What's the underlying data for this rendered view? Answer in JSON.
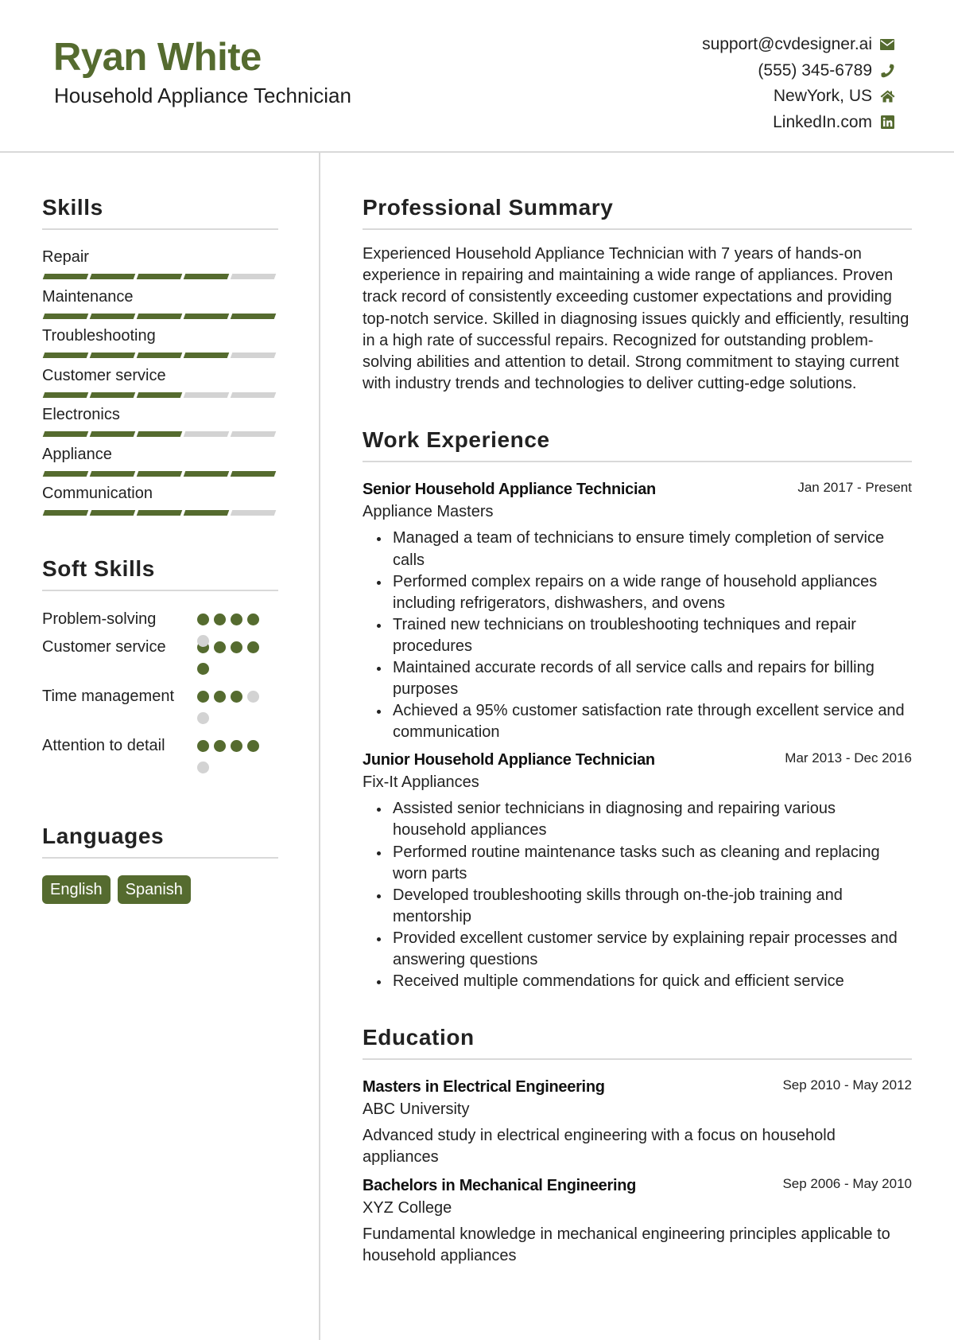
{
  "header": {
    "name": "Ryan White",
    "title": "Household Appliance Technician",
    "contacts": [
      {
        "text": "support@cvdesigner.ai",
        "icon": "envelope-icon"
      },
      {
        "text": "(555) 345-6789",
        "icon": "phone-icon"
      },
      {
        "text": "NewYork, US",
        "icon": "home-icon"
      },
      {
        "text": "LinkedIn.com",
        "icon": "linkedin-icon"
      }
    ]
  },
  "colors": {
    "accent": "#556b2f",
    "inactive": "#d3d3d3",
    "divider": "#d9d9d9"
  },
  "sidebar": {
    "skills": {
      "heading": "Skills",
      "max": 5,
      "items": [
        {
          "name": "Repair",
          "level": 4
        },
        {
          "name": "Maintenance",
          "level": 5
        },
        {
          "name": "Troubleshooting",
          "level": 4
        },
        {
          "name": "Customer service",
          "level": 3
        },
        {
          "name": "Electronics",
          "level": 3
        },
        {
          "name": "Appliance",
          "level": 5
        },
        {
          "name": "Communication",
          "level": 4
        }
      ]
    },
    "soft_skills": {
      "heading": "Soft Skills",
      "max": 5,
      "items": [
        {
          "name": "Problem-solving",
          "level": 4
        },
        {
          "name": "Customer service",
          "level": 5
        },
        {
          "name": "Time management",
          "level": 3
        },
        {
          "name": "Attention to detail",
          "level": 4
        }
      ]
    },
    "languages": {
      "heading": "Languages",
      "items": [
        "English",
        "Spanish"
      ]
    }
  },
  "main": {
    "summary": {
      "heading": "Professional Summary",
      "text": "Experienced Household Appliance Technician with 7 years of hands-on experience in repairing and maintaining a wide range of appliances. Proven track record of consistently exceeding customer expectations and providing top-notch service. Skilled in diagnosing issues quickly and efficiently, resulting in a high rate of successful repairs. Recognized for outstanding problem-solving abilities and attention to detail. Strong commitment to staying current with industry trends and technologies to deliver cutting-edge solutions."
    },
    "work": {
      "heading": "Work Experience",
      "items": [
        {
          "title": "Senior Household Appliance Technician",
          "date": "Jan 2017 - Present",
          "company": "Appliance Masters",
          "bullets": [
            "Managed a team of technicians to ensure timely completion of service calls",
            "Performed complex repairs on a wide range of household appliances including refrigerators, dishwashers, and ovens",
            "Trained new technicians on troubleshooting techniques and repair procedures",
            "Maintained accurate records of all service calls and repairs for billing purposes",
            "Achieved a 95% customer satisfaction rate through excellent service and communication"
          ]
        },
        {
          "title": "Junior Household Appliance Technician",
          "date": "Mar 2013 - Dec 2016",
          "company": "Fix-It Appliances",
          "bullets": [
            "Assisted senior technicians in diagnosing and repairing various household appliances",
            "Performed routine maintenance tasks such as cleaning and replacing worn parts",
            "Developed troubleshooting skills through on-the-job training and mentorship",
            "Provided excellent customer service by explaining repair processes and answering questions",
            "Received multiple commendations for quick and efficient service"
          ]
        }
      ]
    },
    "education": {
      "heading": "Education",
      "items": [
        {
          "degree": "Masters in Electrical Engineering",
          "date": "Sep 2010 - May 2012",
          "school": "ABC University",
          "description": "Advanced study in electrical engineering with a focus on household appliances"
        },
        {
          "degree": "Bachelors in Mechanical Engineering",
          "date": "Sep 2006 - May 2010",
          "school": "XYZ College",
          "description": "Fundamental knowledge in mechanical engineering principles applicable to household appliances"
        }
      ]
    }
  }
}
